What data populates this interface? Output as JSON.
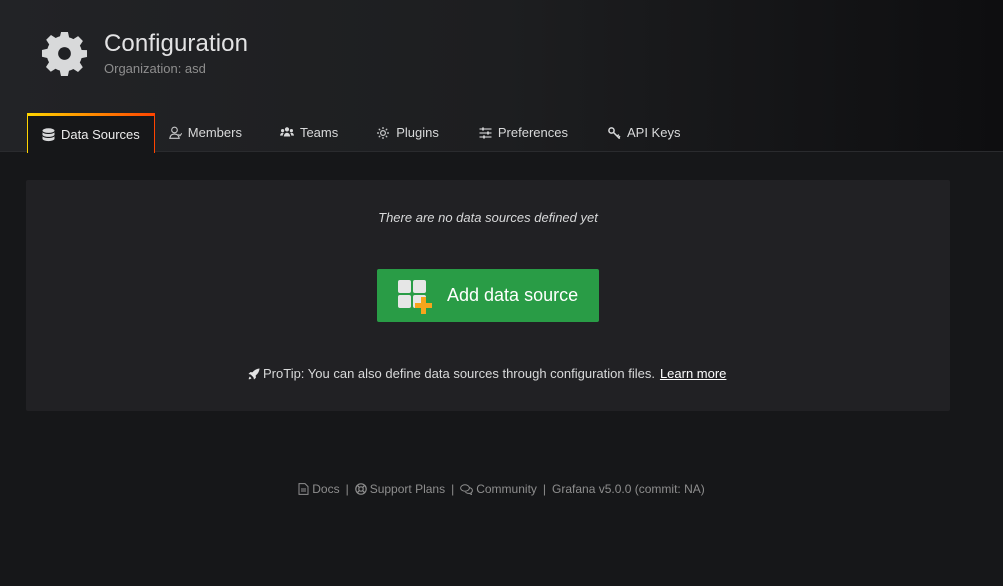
{
  "header": {
    "title": "Configuration",
    "subtitle": "Organization: asd",
    "icon": "gear-icon"
  },
  "tabs": [
    {
      "label": "Data Sources",
      "icon": "database-icon",
      "active": true
    },
    {
      "label": "Members",
      "icon": "user-icon",
      "active": false
    },
    {
      "label": "Teams",
      "icon": "users-icon",
      "active": false
    },
    {
      "label": "Plugins",
      "icon": "plugin-icon",
      "active": false
    },
    {
      "label": "Preferences",
      "icon": "sliders-icon",
      "active": false
    },
    {
      "label": "API Keys",
      "icon": "key-icon",
      "active": false
    }
  ],
  "empty_state": {
    "message": "There are no data sources defined yet",
    "button_label": "Add data source",
    "button_icon": "add-datasource-icon",
    "protip_text": "ProTip: You can also define data sources through configuration files.",
    "protip_icon": "rocket-icon",
    "learn_more": "Learn more"
  },
  "footer": {
    "docs": "Docs",
    "support": "Support Plans",
    "community": "Community",
    "version": "Grafana v5.0.0 (commit: NA)",
    "separator": "|"
  },
  "colors": {
    "accent_green": "#299c46",
    "tab_gradient_start": "#ffd500",
    "tab_gradient_end": "#ff4400",
    "background": "#161719",
    "panel": "#212124"
  }
}
